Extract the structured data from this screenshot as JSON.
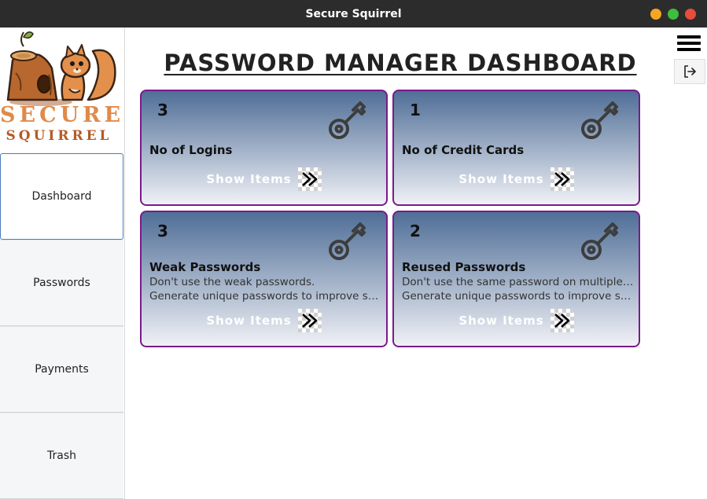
{
  "window": {
    "title": "Secure Squirrel"
  },
  "brand": {
    "line1": "SECURE",
    "line2": "SQUIRREL"
  },
  "sidebar": {
    "items": [
      {
        "label": "Dashboard"
      },
      {
        "label": "Passwords"
      },
      {
        "label": "Payments"
      },
      {
        "label": "Trash"
      }
    ]
  },
  "main": {
    "title": "PASSWORD MANAGER DASHBOARD"
  },
  "cards": [
    {
      "count": "3",
      "label": "No of Logins",
      "desc1": "",
      "desc2": "",
      "action": "Show Items"
    },
    {
      "count": "1",
      "label": "No of Credit Cards",
      "desc1": "",
      "desc2": "",
      "action": "Show Items"
    },
    {
      "count": "3",
      "label": "Weak Passwords",
      "desc1": "Don't use the weak passwords.",
      "desc2": "Generate unique passwords to improve security.",
      "action": "Show Items"
    },
    {
      "count": "2",
      "label": "Reused Passwords",
      "desc1": "Don't use the same password on multiple sites.",
      "desc2": "Generate unique passwords to improve security.",
      "action": "Show Items"
    }
  ],
  "icons": {
    "card": "key-icon",
    "menu": "hamburger-menu-icon",
    "logout": "logout-icon",
    "arrow": "double-chevron-right-icon"
  },
  "colors": {
    "card_border": "#7a1a8a",
    "card_gradient_top": "#4f6e97",
    "card_gradient_bottom": "#f0f1f6",
    "active_nav_border": "#4a7bbf"
  }
}
